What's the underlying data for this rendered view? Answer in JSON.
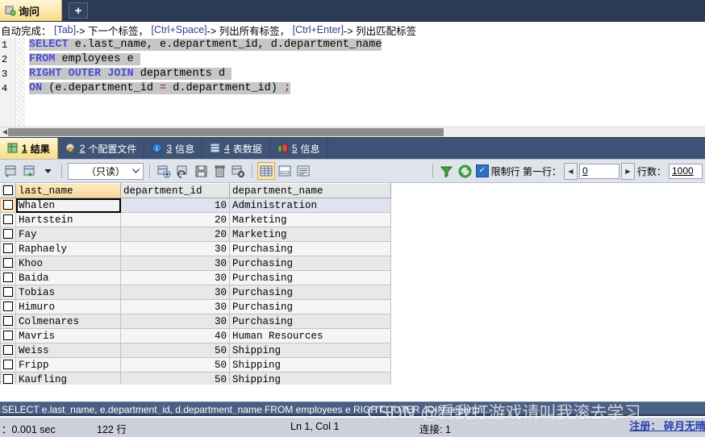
{
  "titlebar": {
    "tab_label": "询问",
    "tab_icon": "query-icon",
    "new_tab_label": "+"
  },
  "hint": {
    "prefix": "自动完成：",
    "key1": "[Tab]",
    "text1": "-> 下一个标签，",
    "key2": "[Ctrl+Space]",
    "text2": "-> 列出所有标签，",
    "key3": "[Ctrl+Enter]",
    "text3": "-> 列出匹配标签"
  },
  "editor": {
    "line_numbers": [
      "1",
      "2",
      "3",
      "4"
    ],
    "lines": [
      "SELECT e.last_name, e.department_id, d.department_name",
      "FROM employees e",
      "RIGHT OUTER JOIN departments d",
      "ON (e.department_id = d.department_id) ;"
    ]
  },
  "result_tabs": [
    {
      "num": "1",
      "label": "结果",
      "icon": "grid-icon",
      "active": true
    },
    {
      "num": "2",
      "label": "个配置文件",
      "icon": "profile-icon",
      "active": false
    },
    {
      "num": "3",
      "label": "信息",
      "icon": "info-icon",
      "active": false
    },
    {
      "num": "4",
      "label": "表数据",
      "icon": "table-icon",
      "active": false
    },
    {
      "num": "5",
      "label": "信息",
      "icon": "chart-icon",
      "active": false
    }
  ],
  "gridbar": {
    "readonly_label": "（只读）",
    "limit_label": "限制行 第一行：",
    "first_row_value": "0",
    "rows_label": "行数：",
    "rows_value": "1000",
    "icons": [
      "export-grid-icon",
      "import-grid-icon",
      "dropdown-arrow-icon",
      "add-row-icon",
      "revert-row-icon",
      "save-icon",
      "delete-row-icon",
      "cancel-row-icon",
      "grid-view-icon",
      "form-view-icon",
      "text-view-icon",
      "filter-icon",
      "refresh-icon"
    ]
  },
  "grid": {
    "columns": [
      "last_name",
      "department_id",
      "department_name"
    ],
    "highlighted_column": "last_name",
    "rows": [
      {
        "last_name": "Whalen",
        "department_id": "10",
        "department_name": "Administration"
      },
      {
        "last_name": "Hartstein",
        "department_id": "20",
        "department_name": "Marketing"
      },
      {
        "last_name": "Fay",
        "department_id": "20",
        "department_name": "Marketing"
      },
      {
        "last_name": "Raphaely",
        "department_id": "30",
        "department_name": "Purchasing"
      },
      {
        "last_name": "Khoo",
        "department_id": "30",
        "department_name": "Purchasing"
      },
      {
        "last_name": "Baida",
        "department_id": "30",
        "department_name": "Purchasing"
      },
      {
        "last_name": "Tobias",
        "department_id": "30",
        "department_name": "Purchasing"
      },
      {
        "last_name": "Himuro",
        "department_id": "30",
        "department_name": "Purchasing"
      },
      {
        "last_name": "Colmenares",
        "department_id": "30",
        "department_name": "Purchasing"
      },
      {
        "last_name": "Mavris",
        "department_id": "40",
        "department_name": "Human Resources"
      },
      {
        "last_name": "Weiss",
        "department_id": "50",
        "department_name": "Shipping"
      },
      {
        "last_name": "Fripp",
        "department_id": "50",
        "department_name": "Shipping"
      },
      {
        "last_name": "Kaufling",
        "department_id": "50",
        "department_name": "Shipping"
      }
    ]
  },
  "sql_status": "SELECT e.last_name, e.department_id, d.department_name FROM employees e RIGHT OUTER JOIN departm...",
  "statusbar": {
    "time": "：0.001 sec",
    "rows": "122 行",
    "caret": "Ln 1, Col 1",
    "connection": "连接: 1"
  },
  "watermark": {
    "main": "CSDN @看我打游戏请叫我滚去学习",
    "register": "注册： 碎月无晴"
  }
}
